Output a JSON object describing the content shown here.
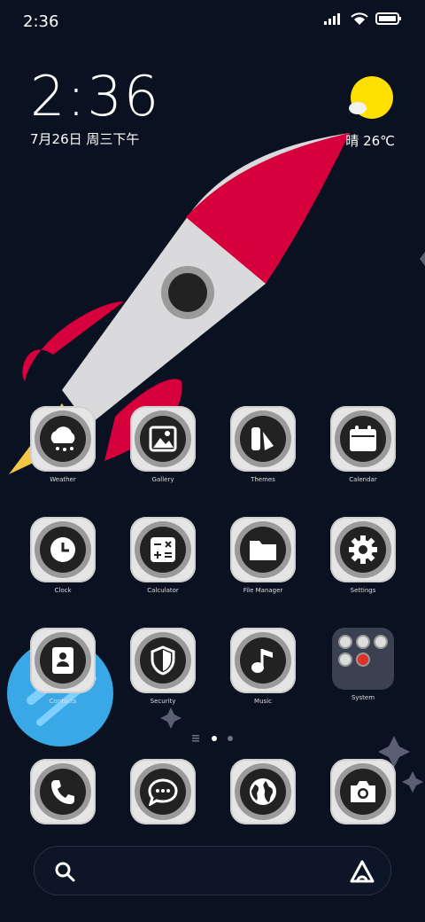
{
  "status_bar": {
    "time": "2:36",
    "icons": [
      "signal-icon",
      "wifi-icon",
      "battery-icon"
    ]
  },
  "clock_widget": {
    "time": "2:36",
    "date": "7月26日 周三下午"
  },
  "weather_widget": {
    "icon": "sun-cloud-icon",
    "text": "晴 26℃"
  },
  "apps": [
    {
      "label": "Weather",
      "icon": "cloud-snow-icon"
    },
    {
      "label": "Gallery",
      "icon": "image-icon"
    },
    {
      "label": "Themes",
      "icon": "themes-icon"
    },
    {
      "label": "Calendar",
      "icon": "calendar-icon"
    },
    {
      "label": "Clock",
      "icon": "clock-icon"
    },
    {
      "label": "Calculator",
      "icon": "calculator-icon"
    },
    {
      "label": "File Manager",
      "icon": "folder-icon"
    },
    {
      "label": "Settings",
      "icon": "gear-icon"
    },
    {
      "label": "Contacts",
      "icon": "contacts-icon"
    },
    {
      "label": "Security",
      "icon": "shield-icon"
    },
    {
      "label": "Music",
      "icon": "music-note-icon"
    },
    {
      "label": "System",
      "icon": "folder-grid-icon"
    }
  ],
  "dock": [
    {
      "icon": "phone-icon"
    },
    {
      "icon": "message-icon"
    },
    {
      "icon": "globe-icon"
    },
    {
      "icon": "camera-icon"
    }
  ],
  "page_indicator": {
    "pages": 2,
    "current": 1
  },
  "search_bar": {
    "left_icon": "search-icon",
    "right_icon": "assistant-icon"
  }
}
